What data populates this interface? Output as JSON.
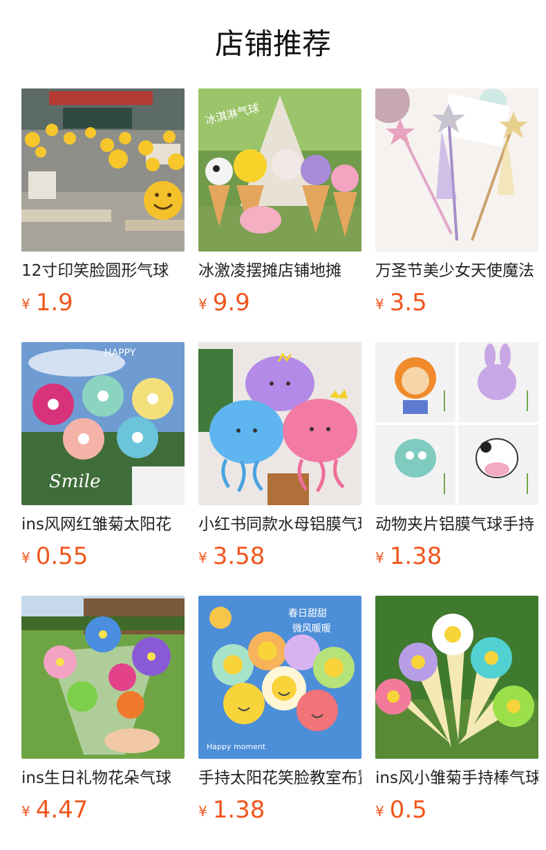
{
  "page": {
    "title": "店铺推荐"
  },
  "currency_symbol": "¥",
  "products": [
    {
      "name": "12寸印笑脸圆形气球",
      "price": "1.9",
      "image": "classroom-smiley-balloons"
    },
    {
      "name": "冰激凌摆摊店铺地摊",
      "price": "9.9",
      "image": "ice-cream-cone-balloons"
    },
    {
      "name": "万圣节美少女天使魔法",
      "price": "3.5",
      "image": "star-fairy-wand"
    },
    {
      "name": "ins风网红雏菊太阳花",
      "price": "0.55",
      "image": "daisy-flower-balloons"
    },
    {
      "name": "小红书同款水母铝膜气球",
      "price": "3.58",
      "image": "jellyfish-balloons"
    },
    {
      "name": "动物夹片铝膜气球手持",
      "price": "1.38",
      "image": "animal-foil-balloons"
    },
    {
      "name": "ins生日礼物花朵气球",
      "price": "4.47",
      "image": "flower-bouquet-balloons"
    },
    {
      "name": "手持太阳花笑脸教室布置",
      "price": "1.38",
      "image": "smiley-sunflower-balloons"
    },
    {
      "name": "ins风小雏菊手持棒气球",
      "price": "0.5",
      "image": "daisy-wand-balloons"
    }
  ]
}
